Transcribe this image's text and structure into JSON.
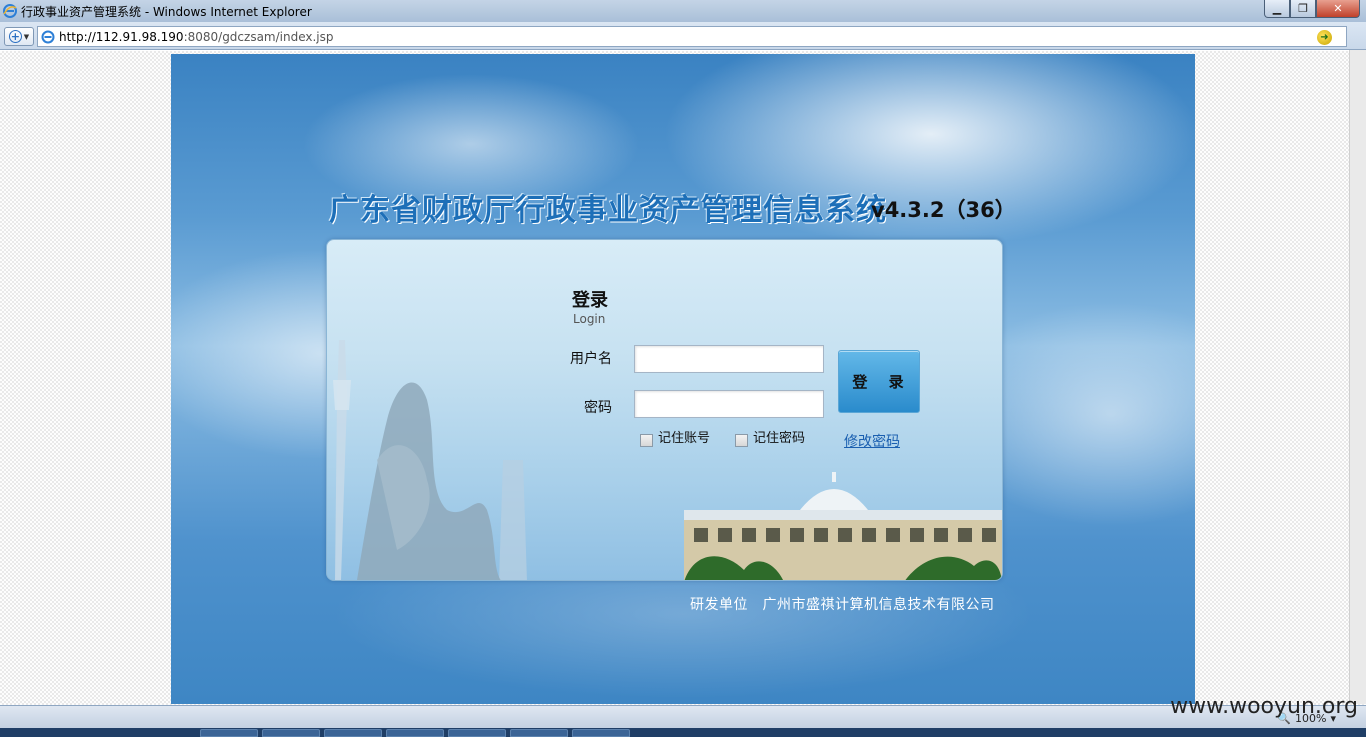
{
  "browser": {
    "window_title": "行政事业资产管理系统 - Windows Internet Explorer",
    "url_host": "http://112.91.98.190",
    "url_path": ":8080/gdczsam/index.jsp",
    "zoom": "100%"
  },
  "login_page": {
    "system_title": "广东省财政厅行政事业资产管理信息系统",
    "version": "v4.3.2（36）",
    "heading": "登录",
    "subheading": "Login",
    "username_label": "用户名",
    "username_value": "",
    "password_label": "密码",
    "password_value": "",
    "login_button": "登 录",
    "remember_account_label": "记住账号",
    "remember_password_label": "记住密码",
    "change_password_link": "修改密码",
    "footer": "研发单位　广州市盛祺计算机信息技术有限公司"
  },
  "watermark": "www.wooyun.org"
}
